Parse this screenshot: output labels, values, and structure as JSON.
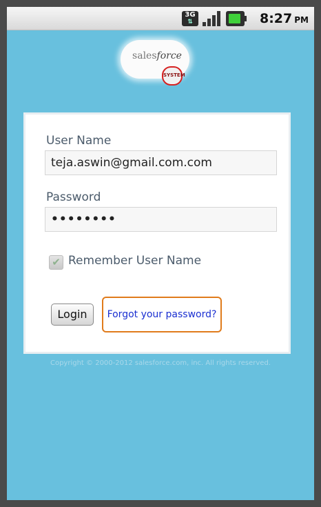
{
  "statusbar": {
    "network_label": "3G",
    "time": "8:27",
    "ampm": "PM",
    "icons": [
      "network-3g-icon",
      "signal-icon",
      "battery-icon"
    ]
  },
  "logo": {
    "text_plain": "sales",
    "text_emph": "force",
    "badge": "SYSTEM"
  },
  "form": {
    "username_label": "User Name",
    "username_value": "teja.aswin@gmail.com.com",
    "password_label": "Password",
    "password_value": "••••••••",
    "remember_label": "Remember User Name",
    "remember_checked": true,
    "login_label": "Login",
    "forgot_label": "Forgot your password?"
  },
  "footer": {
    "copyright": "Copyright © 2000-2012 salesforce.com, inc. All rights reserved."
  },
  "colors": {
    "app_background": "#68c0de",
    "focus_outline": "#e07b1b",
    "link": "#1a2fd1"
  }
}
